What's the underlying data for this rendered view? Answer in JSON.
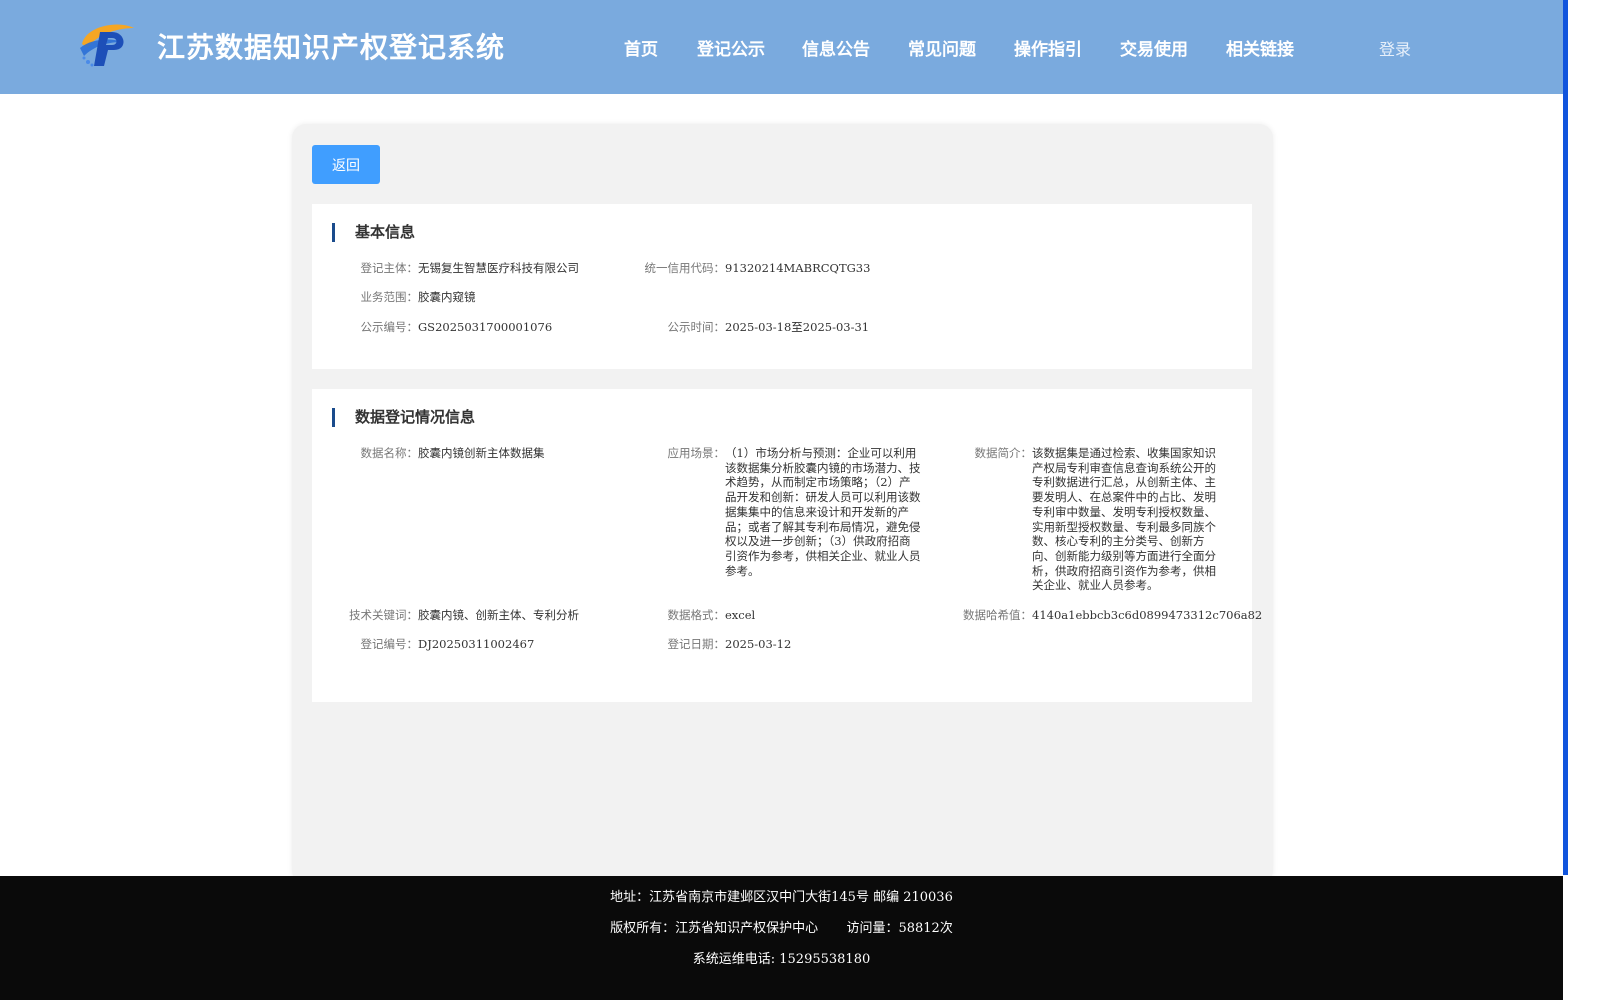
{
  "header": {
    "title": "江苏数据知识产权登记系统",
    "nav": [
      "首页",
      "登记公示",
      "信息公告",
      "常见问题",
      "操作指引",
      "交易使用",
      "相关链接"
    ],
    "login": "登录"
  },
  "back_label": "返回",
  "basic": {
    "title": "基本信息",
    "subject_label": "登记主体：",
    "subject": "无锡复生智慧医疗科技有限公司",
    "credit_label": "统一信用代码：",
    "credit": "91320214MABRCQTG33",
    "scope_label": "业务范围：",
    "scope": "胶囊内窥镜",
    "notice_no_label": "公示编号：",
    "notice_no": "GS2025031700001076",
    "notice_time_label": "公示时间：",
    "notice_time": "2025-03-18至2025-03-31"
  },
  "registration": {
    "title": "数据登记情况信息",
    "name_label": "数据名称：",
    "name": "胶囊内镜创新主体数据集",
    "scene_label": "应用场景：",
    "scene": "（1）市场分析与预测：企业可以利用该数据集分析胶囊内镜的市场潜力、技术趋势，从而制定市场策略；（2）产品开发和创新：研发人员可以利用该数据集集中的信息来设计和开发新的产品；或者了解其专利布局情况，避免侵权以及进一步创新；（3）供政府招商引资作为参考，供相关企业、就业人员参考。",
    "intro_label": "数据简介：",
    "intro": "该数据集是通过检索、收集国家知识产权局专利审查信息查询系统公开的专利数据进行汇总，从创新主体、主要发明人、在总案件中的占比、发明专利审中数量、发明专利授权数量、实用新型授权数量、专利最多同族个数、核心专利的主分类号、创新方向、创新能力级别等方面进行全面分析，供政府招商引资作为参考，供相关企业、就业人员参考。",
    "keywords_label": "技术关键词：",
    "keywords": "胶囊内镜、创新主体、专利分析",
    "format_label": "数据格式：",
    "format": "excel",
    "hash_label": "数据哈希值：",
    "hash": "4140a1ebbcb3c6d0899473312c706a82",
    "reg_no_label": "登记编号：",
    "reg_no": "DJ20250311002467",
    "reg_date_label": "登记日期：",
    "reg_date": "2025-03-12"
  },
  "footer": {
    "address": "地址：江苏省南京市建邺区汉中门大街145号 邮编 210036",
    "copyright": "版权所有：江苏省知识产权保护中心",
    "visits": "访问量：58812次",
    "phone": "系统运维电话: 15295538180"
  }
}
